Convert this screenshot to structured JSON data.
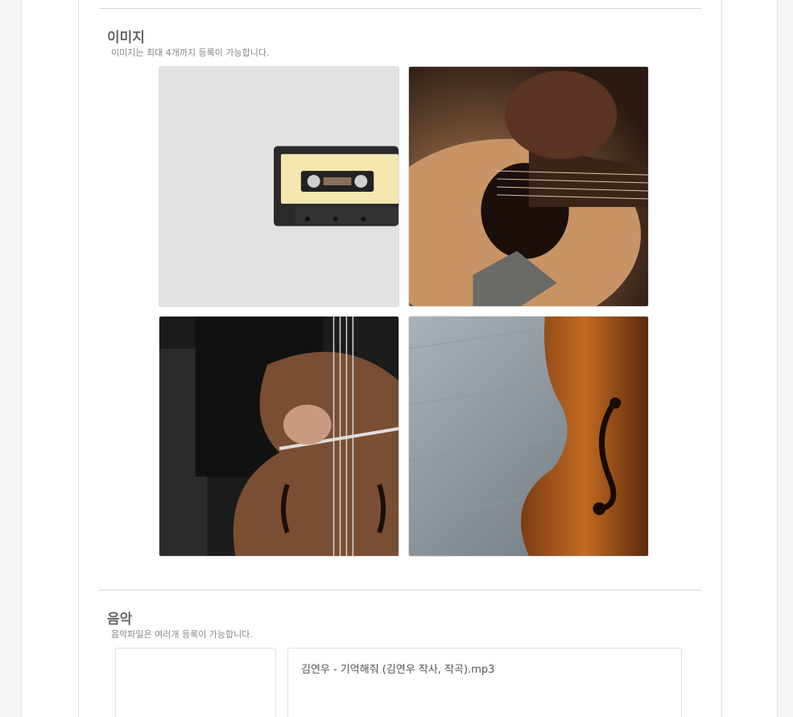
{
  "image_section": {
    "title": "이미지",
    "subtitle": "이미지는 최대 4개까지 등록이 가능합니다.",
    "images": [
      {
        "name": "cassette-tape-image"
      },
      {
        "name": "acoustic-guitar-image"
      },
      {
        "name": "cello-player-image"
      },
      {
        "name": "violin-image"
      }
    ]
  },
  "music_section": {
    "title": "음악",
    "subtitle": "음악파일은 여러개 등록이 가능합니다.",
    "files": [
      "김연우 - 기억해줘 (김연우 작사, 작곡).mp3"
    ]
  },
  "colors": {
    "background": "#f7f7f7",
    "panel": "#ffffff",
    "divider": "#d6d6d6"
  }
}
